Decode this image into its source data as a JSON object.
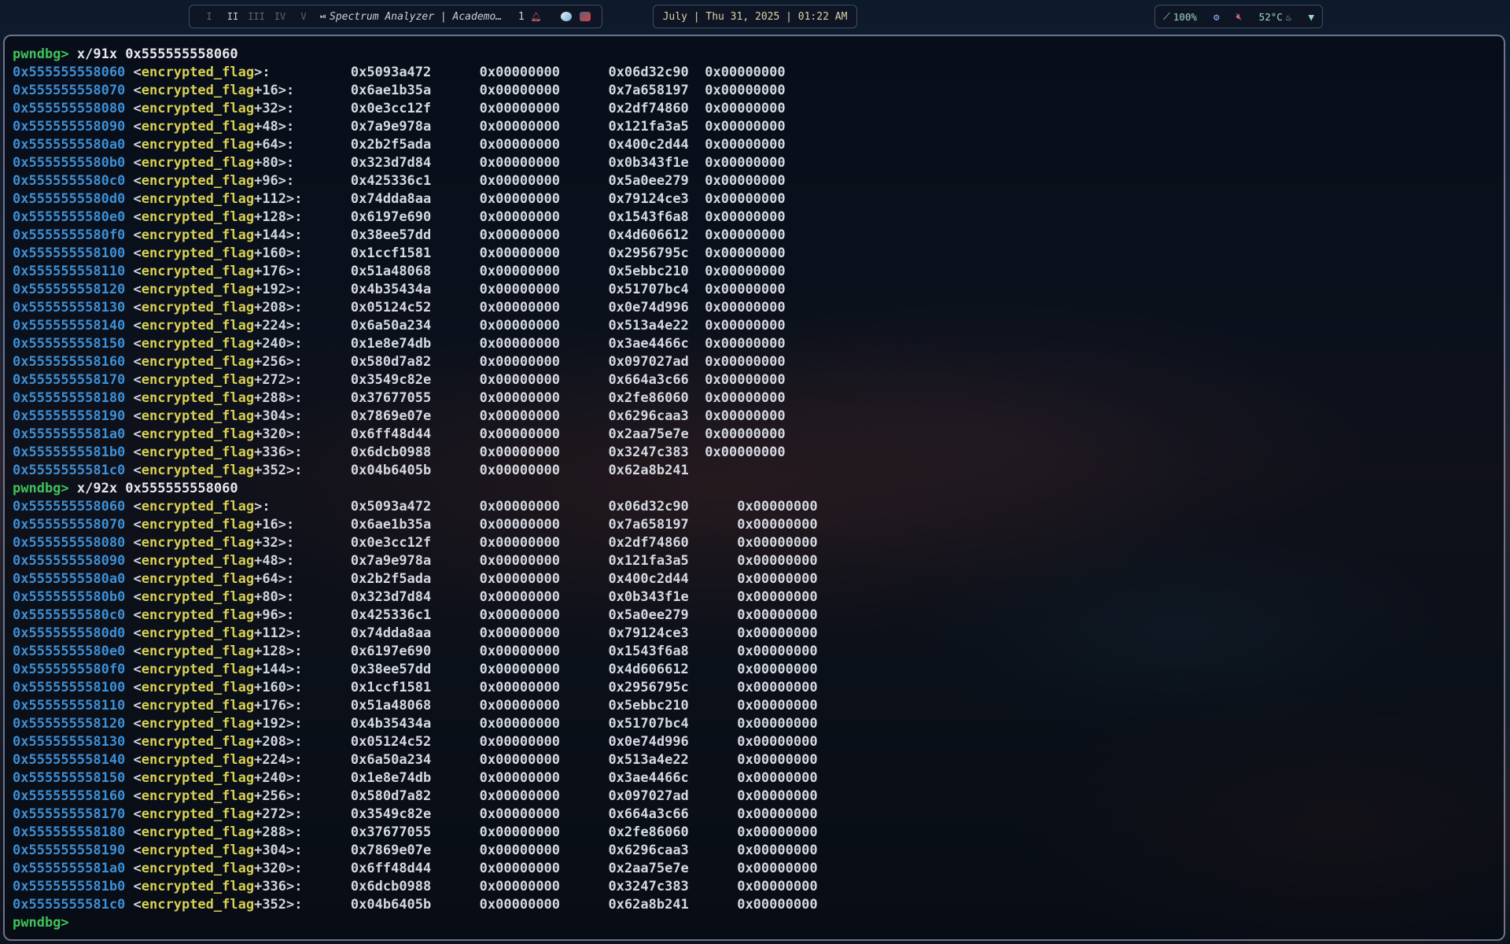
{
  "topbar": {
    "workspaces": [
      "I",
      "II",
      "III",
      "IV",
      "V"
    ],
    "active_workspace": "II",
    "media_title": "Spectrum Analyzer | Academo…",
    "notification_count": "1",
    "clock": "July | Thu 31, 2025 | 01:22 AM",
    "status": {
      "cpu": "100%",
      "temperature": "52°C"
    }
  },
  "terminal": {
    "prompt": "pwndbg>",
    "commands": [
      "x/91x 0x555555558060",
      "x/92x 0x555555558060"
    ],
    "dumps": [
      {
        "rows": [
          {
            "addr": "0x555555558060",
            "sym": "encrypted_flag",
            "off": "",
            "v": [
              "0x5093a472",
              "0x00000000",
              "0x06d32c90",
              "0x00000000"
            ]
          },
          {
            "addr": "0x555555558070",
            "sym": "encrypted_flag",
            "off": "+16",
            "v": [
              "0x6ae1b35a",
              "0x00000000",
              "0x7a658197",
              "0x00000000"
            ]
          },
          {
            "addr": "0x555555558080",
            "sym": "encrypted_flag",
            "off": "+32",
            "v": [
              "0x0e3cc12f",
              "0x00000000",
              "0x2df74860",
              "0x00000000"
            ]
          },
          {
            "addr": "0x555555558090",
            "sym": "encrypted_flag",
            "off": "+48",
            "v": [
              "0x7a9e978a",
              "0x00000000",
              "0x121fa3a5",
              "0x00000000"
            ]
          },
          {
            "addr": "0x5555555580a0",
            "sym": "encrypted_flag",
            "off": "+64",
            "v": [
              "0x2b2f5ada",
              "0x00000000",
              "0x400c2d44",
              "0x00000000"
            ]
          },
          {
            "addr": "0x5555555580b0",
            "sym": "encrypted_flag",
            "off": "+80",
            "v": [
              "0x323d7d84",
              "0x00000000",
              "0x0b343f1e",
              "0x00000000"
            ]
          },
          {
            "addr": "0x5555555580c0",
            "sym": "encrypted_flag",
            "off": "+96",
            "v": [
              "0x425336c1",
              "0x00000000",
              "0x5a0ee279",
              "0x00000000"
            ]
          },
          {
            "addr": "0x5555555580d0",
            "sym": "encrypted_flag",
            "off": "+112",
            "v": [
              "0x74dda8aa",
              "0x00000000",
              "0x79124ce3",
              "0x00000000"
            ]
          },
          {
            "addr": "0x5555555580e0",
            "sym": "encrypted_flag",
            "off": "+128",
            "v": [
              "0x6197e690",
              "0x00000000",
              "0x1543f6a8",
              "0x00000000"
            ]
          },
          {
            "addr": "0x5555555580f0",
            "sym": "encrypted_flag",
            "off": "+144",
            "v": [
              "0x38ee57dd",
              "0x00000000",
              "0x4d606612",
              "0x00000000"
            ]
          },
          {
            "addr": "0x555555558100",
            "sym": "encrypted_flag",
            "off": "+160",
            "v": [
              "0x1ccf1581",
              "0x00000000",
              "0x2956795c",
              "0x00000000"
            ]
          },
          {
            "addr": "0x555555558110",
            "sym": "encrypted_flag",
            "off": "+176",
            "v": [
              "0x51a48068",
              "0x00000000",
              "0x5ebbc210",
              "0x00000000"
            ]
          },
          {
            "addr": "0x555555558120",
            "sym": "encrypted_flag",
            "off": "+192",
            "v": [
              "0x4b35434a",
              "0x00000000",
              "0x51707bc4",
              "0x00000000"
            ]
          },
          {
            "addr": "0x555555558130",
            "sym": "encrypted_flag",
            "off": "+208",
            "v": [
              "0x05124c52",
              "0x00000000",
              "0x0e74d996",
              "0x00000000"
            ]
          },
          {
            "addr": "0x555555558140",
            "sym": "encrypted_flag",
            "off": "+224",
            "v": [
              "0x6a50a234",
              "0x00000000",
              "0x513a4e22",
              "0x00000000"
            ]
          },
          {
            "addr": "0x555555558150",
            "sym": "encrypted_flag",
            "off": "+240",
            "v": [
              "0x1e8e74db",
              "0x00000000",
              "0x3ae4466c",
              "0x00000000"
            ]
          },
          {
            "addr": "0x555555558160",
            "sym": "encrypted_flag",
            "off": "+256",
            "v": [
              "0x580d7a82",
              "0x00000000",
              "0x097027ad",
              "0x00000000"
            ]
          },
          {
            "addr": "0x555555558170",
            "sym": "encrypted_flag",
            "off": "+272",
            "v": [
              "0x3549c82e",
              "0x00000000",
              "0x664a3c66",
              "0x00000000"
            ]
          },
          {
            "addr": "0x555555558180",
            "sym": "encrypted_flag",
            "off": "+288",
            "v": [
              "0x37677055",
              "0x00000000",
              "0x2fe86060",
              "0x00000000"
            ]
          },
          {
            "addr": "0x555555558190",
            "sym": "encrypted_flag",
            "off": "+304",
            "v": [
              "0x7869e07e",
              "0x00000000",
              "0x6296caa3",
              "0x00000000"
            ]
          },
          {
            "addr": "0x5555555581a0",
            "sym": "encrypted_flag",
            "off": "+320",
            "v": [
              "0x6ff48d44",
              "0x00000000",
              "0x2aa75e7e",
              "0x00000000"
            ]
          },
          {
            "addr": "0x5555555581b0",
            "sym": "encrypted_flag",
            "off": "+336",
            "v": [
              "0x6dcb0988",
              "0x00000000",
              "0x3247c383",
              "0x00000000"
            ]
          },
          {
            "addr": "0x5555555581c0",
            "sym": "encrypted_flag",
            "off": "+352",
            "v": [
              "0x04b6405b",
              "0x00000000",
              "0x62a8b241"
            ]
          }
        ]
      },
      {
        "rows": [
          {
            "addr": "0x555555558060",
            "sym": "encrypted_flag",
            "off": "",
            "v": [
              "0x5093a472",
              "0x00000000",
              "0x06d32c90",
              "0x00000000"
            ]
          },
          {
            "addr": "0x555555558070",
            "sym": "encrypted_flag",
            "off": "+16",
            "v": [
              "0x6ae1b35a",
              "0x00000000",
              "0x7a658197",
              "0x00000000"
            ]
          },
          {
            "addr": "0x555555558080",
            "sym": "encrypted_flag",
            "off": "+32",
            "v": [
              "0x0e3cc12f",
              "0x00000000",
              "0x2df74860",
              "0x00000000"
            ]
          },
          {
            "addr": "0x555555558090",
            "sym": "encrypted_flag",
            "off": "+48",
            "v": [
              "0x7a9e978a",
              "0x00000000",
              "0x121fa3a5",
              "0x00000000"
            ]
          },
          {
            "addr": "0x5555555580a0",
            "sym": "encrypted_flag",
            "off": "+64",
            "v": [
              "0x2b2f5ada",
              "0x00000000",
              "0x400c2d44",
              "0x00000000"
            ]
          },
          {
            "addr": "0x5555555580b0",
            "sym": "encrypted_flag",
            "off": "+80",
            "v": [
              "0x323d7d84",
              "0x00000000",
              "0x0b343f1e",
              "0x00000000"
            ]
          },
          {
            "addr": "0x5555555580c0",
            "sym": "encrypted_flag",
            "off": "+96",
            "v": [
              "0x425336c1",
              "0x00000000",
              "0x5a0ee279",
              "0x00000000"
            ]
          },
          {
            "addr": "0x5555555580d0",
            "sym": "encrypted_flag",
            "off": "+112",
            "v": [
              "0x74dda8aa",
              "0x00000000",
              "0x79124ce3",
              "0x00000000"
            ]
          },
          {
            "addr": "0x5555555580e0",
            "sym": "encrypted_flag",
            "off": "+128",
            "v": [
              "0x6197e690",
              "0x00000000",
              "0x1543f6a8",
              "0x00000000"
            ]
          },
          {
            "addr": "0x5555555580f0",
            "sym": "encrypted_flag",
            "off": "+144",
            "v": [
              "0x38ee57dd",
              "0x00000000",
              "0x4d606612",
              "0x00000000"
            ]
          },
          {
            "addr": "0x555555558100",
            "sym": "encrypted_flag",
            "off": "+160",
            "v": [
              "0x1ccf1581",
              "0x00000000",
              "0x2956795c",
              "0x00000000"
            ]
          },
          {
            "addr": "0x555555558110",
            "sym": "encrypted_flag",
            "off": "+176",
            "v": [
              "0x51a48068",
              "0x00000000",
              "0x5ebbc210",
              "0x00000000"
            ]
          },
          {
            "addr": "0x555555558120",
            "sym": "encrypted_flag",
            "off": "+192",
            "v": [
              "0x4b35434a",
              "0x00000000",
              "0x51707bc4",
              "0x00000000"
            ]
          },
          {
            "addr": "0x555555558130",
            "sym": "encrypted_flag",
            "off": "+208",
            "v": [
              "0x05124c52",
              "0x00000000",
              "0x0e74d996",
              "0x00000000"
            ]
          },
          {
            "addr": "0x555555558140",
            "sym": "encrypted_flag",
            "off": "+224",
            "v": [
              "0x6a50a234",
              "0x00000000",
              "0x513a4e22",
              "0x00000000"
            ]
          },
          {
            "addr": "0x555555558150",
            "sym": "encrypted_flag",
            "off": "+240",
            "v": [
              "0x1e8e74db",
              "0x00000000",
              "0x3ae4466c",
              "0x00000000"
            ]
          },
          {
            "addr": "0x555555558160",
            "sym": "encrypted_flag",
            "off": "+256",
            "v": [
              "0x580d7a82",
              "0x00000000",
              "0x097027ad",
              "0x00000000"
            ]
          },
          {
            "addr": "0x555555558170",
            "sym": "encrypted_flag",
            "off": "+272",
            "v": [
              "0x3549c82e",
              "0x00000000",
              "0x664a3c66",
              "0x00000000"
            ]
          },
          {
            "addr": "0x555555558180",
            "sym": "encrypted_flag",
            "off": "+288",
            "v": [
              "0x37677055",
              "0x00000000",
              "0x2fe86060",
              "0x00000000"
            ]
          },
          {
            "addr": "0x555555558190",
            "sym": "encrypted_flag",
            "off": "+304",
            "v": [
              "0x7869e07e",
              "0x00000000",
              "0x6296caa3",
              "0x00000000"
            ]
          },
          {
            "addr": "0x5555555581a0",
            "sym": "encrypted_flag",
            "off": "+320",
            "v": [
              "0x6ff48d44",
              "0x00000000",
              "0x2aa75e7e",
              "0x00000000"
            ]
          },
          {
            "addr": "0x5555555581b0",
            "sym": "encrypted_flag",
            "off": "+336",
            "v": [
              "0x6dcb0988",
              "0x00000000",
              "0x3247c383",
              "0x00000000"
            ]
          },
          {
            "addr": "0x5555555581c0",
            "sym": "encrypted_flag",
            "off": "+352",
            "v": [
              "0x04b6405b",
              "0x00000000",
              "0x62a8b241",
              "0x00000000"
            ]
          }
        ]
      }
    ]
  },
  "colors": {
    "prompt": "#3fc25a",
    "address": "#3d8fd6",
    "symbol": "#d8cf52",
    "value": "#d6d9e2",
    "accent": "#9fd9c0"
  }
}
